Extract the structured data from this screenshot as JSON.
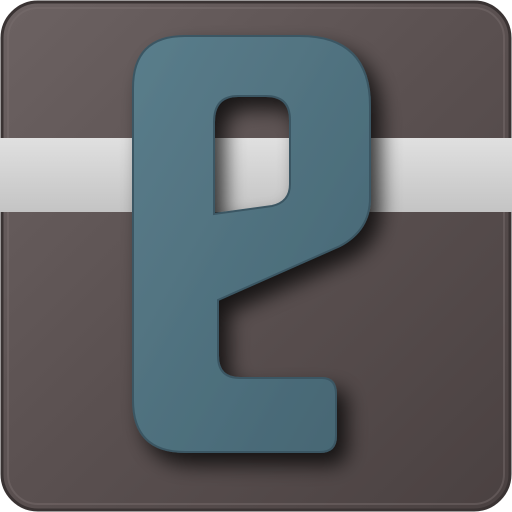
{
  "icon": {
    "name": "e-letter-app-icon",
    "glyph": "e",
    "colors": {
      "tile": "#5a5050",
      "tile_edge": "#3a3333",
      "stripe": "#cfcfcf",
      "letter": "#4d6e7b",
      "letter_edge": "#3b5763"
    }
  }
}
